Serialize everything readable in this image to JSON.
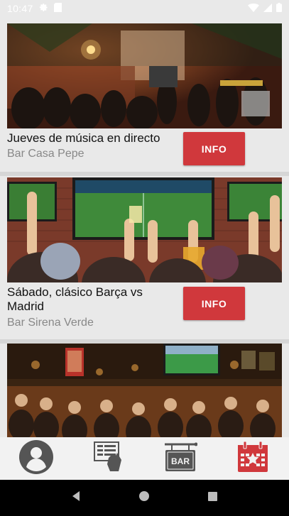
{
  "status_bar": {
    "time": "10:47"
  },
  "events": [
    {
      "title": "Jueves de música en directo",
      "venue": "Bar Casa Pepe",
      "button": "INFO"
    },
    {
      "title": "Sábado, clásico Barça vs Madrid",
      "venue": "Bar Sirena Verde",
      "button": "INFO"
    },
    {
      "title": "",
      "venue": "",
      "button": ""
    }
  ],
  "bottom_nav": {
    "items": [
      {
        "icon": "profile-icon"
      },
      {
        "icon": "offers-icon"
      },
      {
        "icon": "bar-sign-icon",
        "label": "BAR"
      },
      {
        "icon": "calendar-icon",
        "active": true
      }
    ],
    "active_color": "#d0383c",
    "inactive_color": "#555555"
  },
  "accent_color": "#d0383c"
}
